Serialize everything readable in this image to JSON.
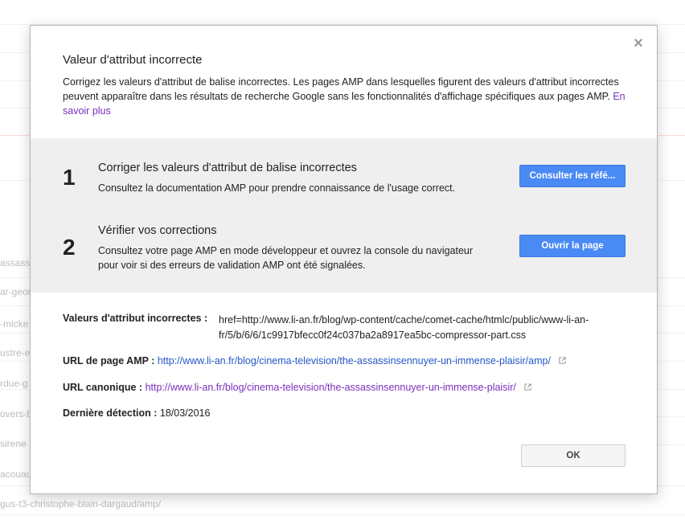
{
  "background": {
    "links": [
      "assassi",
      "ar-geor",
      "-micke",
      "ustre-e",
      "rdue-g",
      "overs-b",
      "sirene",
      "acouau",
      "gus-t3-christophe-blain-dargaud/amp/"
    ]
  },
  "modal": {
    "title": "Valeur d'attribut incorrecte",
    "description": "Corrigez les valeurs d'attribut de balise incorrectes. Les pages AMP dans lesquelles figurent des valeurs d'attribut incorrectes peuvent apparaître dans les résultats de recherche Google sans les fonctionnalités d'affichage spécifiques aux pages AMP.",
    "learn_more": "En savoir plus",
    "close_symbol": "×",
    "steps": [
      {
        "number": "1",
        "title": "Corriger les valeurs d'attribut de balise incorrectes",
        "text": "Consultez la documentation AMP pour prendre connaissance de l'usage correct.",
        "button": "Consulter les réfé..."
      },
      {
        "number": "2",
        "title": "Vérifier vos corrections",
        "text": "Consultez votre page AMP en mode développeur et ouvrez la console du navigateur pour voir si des erreurs de validation AMP ont été signalées.",
        "button": "Ouvrir la page"
      }
    ],
    "details": {
      "invalid_label": "Valeurs d'attribut incorrectes :",
      "invalid_value": "href=http://www.li-an.fr/blog/wp-content/cache/comet-cache/htmlc/public/www-li-an-fr/5/b/6/6/1c9917bfecc0f24c037ba2a8917ea5bc-compressor-part.css",
      "amp_url_label": "URL de page AMP :",
      "amp_url": "http://www.li-an.fr/blog/cinema-television/the-assassinsennuyer-un-immense-plaisir/amp/",
      "canonical_label": "URL canonique :",
      "canonical_url": "http://www.li-an.fr/blog/cinema-television/the-assassinsennuyer-un-immense-plaisir/",
      "last_detected_label": "Dernière détection :",
      "last_detected_value": "18/03/2016"
    },
    "ok_button": "OK"
  },
  "colors": {
    "accent_blue": "#4a8af4",
    "link_blue": "#2457c5",
    "link_visited": "#7b2fbe",
    "steps_background": "#efefef"
  }
}
